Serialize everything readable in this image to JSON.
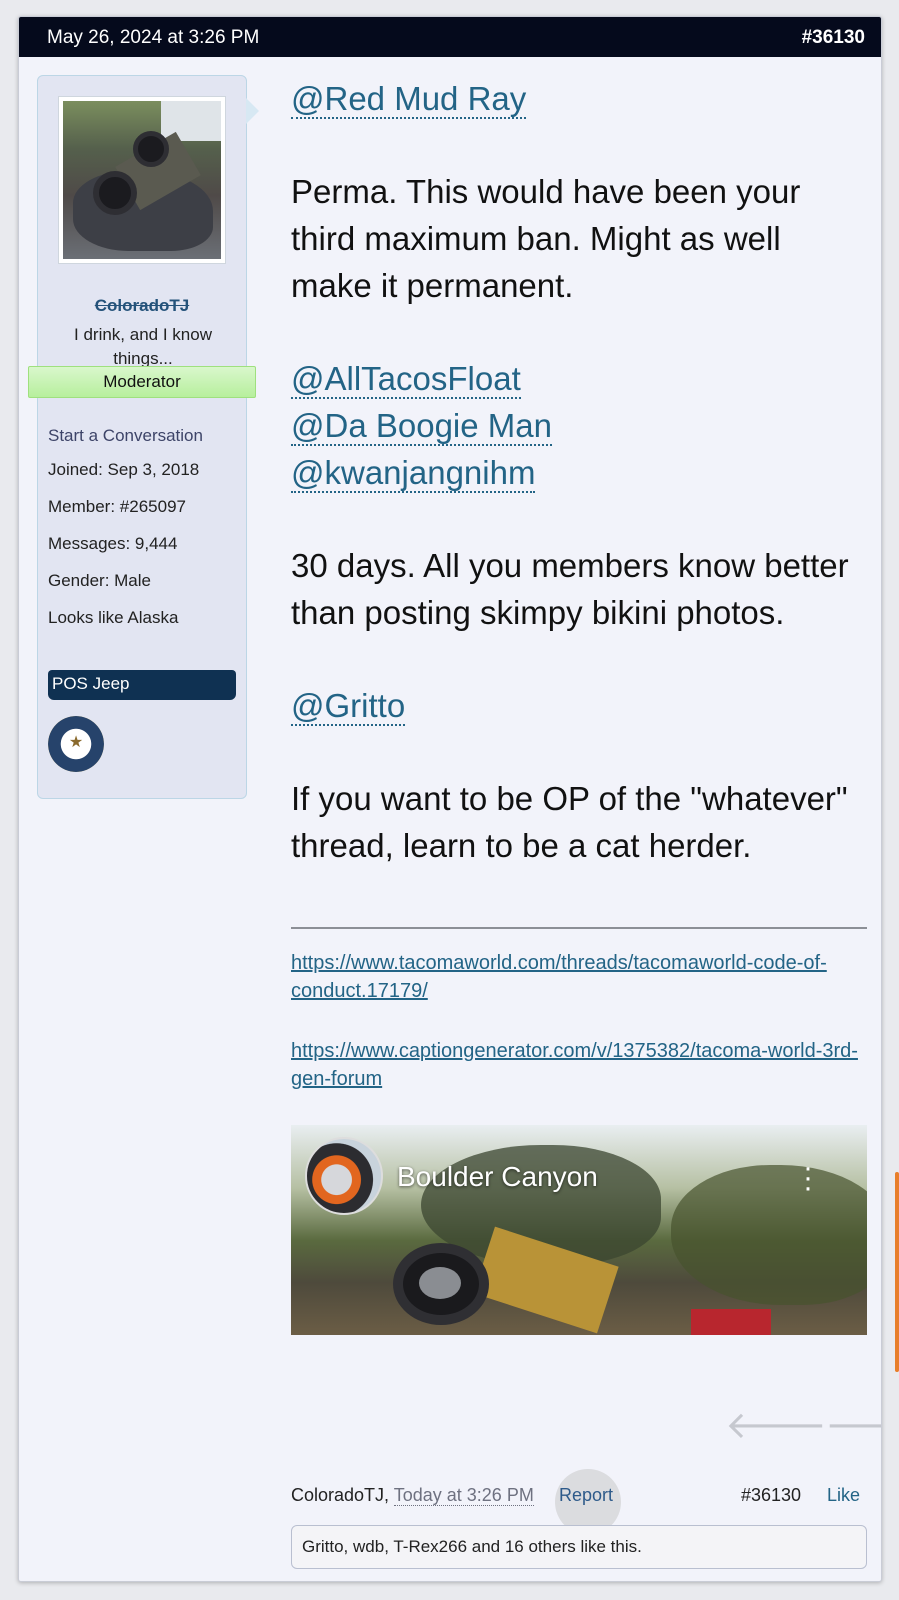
{
  "header": {
    "date": "May 26, 2024 at 3:26 PM",
    "post_number": "#36130"
  },
  "user": {
    "name": "ColoradoTJ",
    "title": "I drink, and I know things...",
    "role": "Moderator",
    "start_conversation": "Start a Conversation",
    "stats": [
      "Joined:  Sep 3, 2018",
      "Member:  #265097",
      "Messages:  9,444",
      "Gender:  Male",
      "Looks like Alaska"
    ],
    "vehicle_badge": "POS Jeep"
  },
  "message": {
    "mention1": "@Red Mud Ray",
    "para1": "Perma. This would have been your third maximum ban. Might as well make it permanent.",
    "mention2": "@AllTacosFloat",
    "mention3": "@Da Boogie Man",
    "mention4": "@kwanjangnihm",
    "para2": "30 days. All you members know better than posting skimpy bikini photos.",
    "mention5": "@Gritto",
    "para3": "If you want to be OP of the \"whatever\" thread, learn to be a cat herder."
  },
  "signature": {
    "link1": "https://www.tacomaworld.com/threads/tacomaworld-code-of-conduct.17179/",
    "link2": "https://www.captiongenerator.com/v/1375382/tacoma-world-3rd-gen-forum"
  },
  "video": {
    "title": "Boulder Canyon"
  },
  "footer": {
    "author": "ColoradoTJ,",
    "time": "Today at 3:26 PM",
    "report": "Report",
    "post_number": "#36130",
    "like": "Like"
  },
  "likes_summary": "Gritto, wdb, T-Rex266 and 16 others like this."
}
